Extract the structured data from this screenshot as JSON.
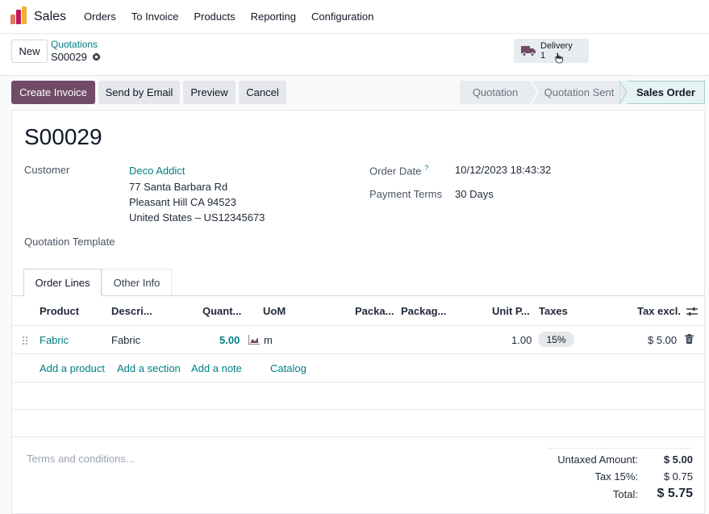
{
  "navbar": {
    "app_name": "Sales",
    "menu": [
      "Orders",
      "To Invoice",
      "Products",
      "Reporting",
      "Configuration"
    ]
  },
  "control": {
    "new_label": "New",
    "breadcrumb_parent": "Quotations",
    "breadcrumb_current": "S00029",
    "delivery_label": "Delivery",
    "delivery_count": "1"
  },
  "actions": {
    "create_invoice": "Create Invoice",
    "send_email": "Send by Email",
    "preview": "Preview",
    "cancel": "Cancel"
  },
  "status": {
    "stages": [
      "Quotation",
      "Quotation Sent",
      "Sales Order"
    ],
    "active": "Sales Order"
  },
  "form": {
    "title": "S00029",
    "customer_label": "Customer",
    "customer_name": "Deco Addict",
    "address_line1": "77 Santa Barbara Rd",
    "address_line2": "Pleasant Hill CA 94523",
    "address_line3": "United States – US12345673",
    "order_date_label": "Order Date",
    "order_date_help": "?",
    "order_date": "10/12/2023 18:43:32",
    "payment_terms_label": "Payment Terms",
    "payment_terms": "30 Days",
    "template_label": "Quotation Template"
  },
  "tabs": [
    "Order Lines",
    "Other Info"
  ],
  "table": {
    "headers": [
      "Product",
      "Descri...",
      "Quant...",
      "UoM",
      "Packa...",
      "Packag...",
      "Unit P...",
      "Taxes",
      "Tax excl."
    ],
    "rows": [
      {
        "product": "Fabric",
        "description": "Fabric",
        "quantity": "5.00",
        "uom": "m",
        "unit_price": "1.00",
        "taxes": "15%",
        "subtotal": "$ 5.00"
      }
    ],
    "add_links": [
      "Add a product",
      "Add a section",
      "Add a note",
      "Catalog"
    ]
  },
  "footer": {
    "terms_placeholder": "Terms and conditions...",
    "untaxed_label": "Untaxed Amount:",
    "untaxed_value": "$ 5.00",
    "tax_label": "Tax 15%:",
    "tax_value": "$ 0.75",
    "total_label": "Total:",
    "total_value": "$ 5.75"
  },
  "colors": {
    "primary": "#714b67",
    "link": "#017e84"
  }
}
